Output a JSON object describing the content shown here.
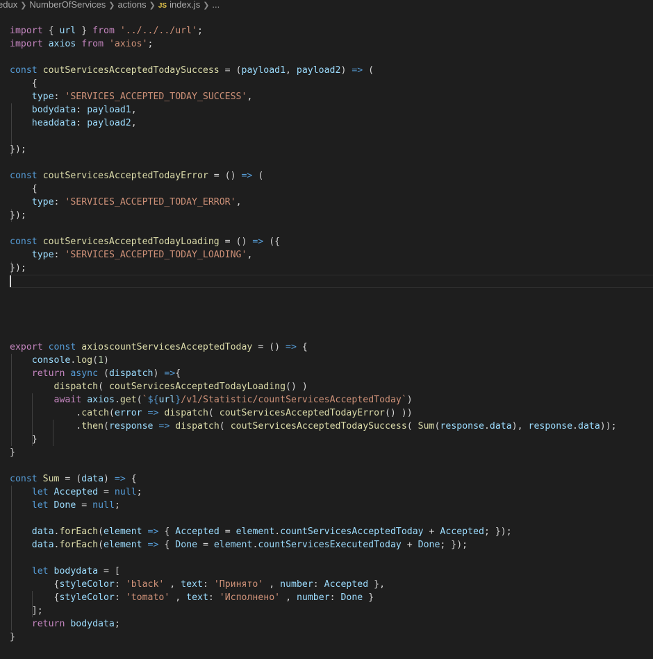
{
  "breadcrumb": {
    "items": [
      "edux",
      "NumberOfServices",
      "actions"
    ],
    "file_badge": "JS",
    "file_name": "index.js",
    "more": "..."
  },
  "editor": {
    "lines": [
      [
        [
          "kc",
          "import"
        ],
        [
          "t",
          " { "
        ],
        [
          "p",
          "url"
        ],
        [
          "t",
          " } "
        ],
        [
          "kc",
          "from"
        ],
        [
          "t",
          " "
        ],
        [
          "s",
          "'../../../url'"
        ],
        [
          "t",
          ";"
        ]
      ],
      [
        [
          "kc",
          "import"
        ],
        [
          "t",
          " "
        ],
        [
          "p",
          "axios"
        ],
        [
          "t",
          " "
        ],
        [
          "kc",
          "from"
        ],
        [
          "t",
          " "
        ],
        [
          "s",
          "'axios'"
        ],
        [
          "t",
          ";"
        ]
      ],
      [],
      [
        [
          "k",
          "const"
        ],
        [
          "t",
          " "
        ],
        [
          "fn",
          "coutServicesAcceptedTodaySuccess"
        ],
        [
          "t",
          " = ("
        ],
        [
          "p",
          "payload1"
        ],
        [
          "t",
          ", "
        ],
        [
          "p",
          "payload2"
        ],
        [
          "t",
          ") "
        ],
        [
          "k",
          "=>"
        ],
        [
          "t",
          " ("
        ]
      ],
      [
        [
          "t",
          "    {"
        ]
      ],
      [
        [
          "t",
          "    "
        ],
        [
          "p",
          "type"
        ],
        [
          "t",
          ": "
        ],
        [
          "s",
          "'SERVICES_ACCEPTED_TODAY_SUCCESS'"
        ],
        [
          "t",
          ","
        ]
      ],
      [
        [
          "t",
          "    "
        ],
        [
          "p",
          "bodydata"
        ],
        [
          "t",
          ": "
        ],
        [
          "p",
          "payload1"
        ],
        [
          "t",
          ","
        ]
      ],
      [
        [
          "t",
          "    "
        ],
        [
          "p",
          "headdata"
        ],
        [
          "t",
          ": "
        ],
        [
          "p",
          "payload2"
        ],
        [
          "t",
          ","
        ]
      ],
      [],
      [
        [
          "t",
          "});"
        ]
      ],
      [],
      [
        [
          "k",
          "const"
        ],
        [
          "t",
          " "
        ],
        [
          "fn",
          "coutServicesAcceptedTodayError"
        ],
        [
          "t",
          " = () "
        ],
        [
          "k",
          "=>"
        ],
        [
          "t",
          " ("
        ]
      ],
      [
        [
          "t",
          "    {"
        ]
      ],
      [
        [
          "t",
          "    "
        ],
        [
          "p",
          "type"
        ],
        [
          "t",
          ": "
        ],
        [
          "s",
          "'SERVICES_ACCEPTED_TODAY_ERROR'"
        ],
        [
          "t",
          ","
        ]
      ],
      [
        [
          "t",
          "});"
        ]
      ],
      [],
      [
        [
          "k",
          "const"
        ],
        [
          "t",
          " "
        ],
        [
          "fn",
          "coutServicesAcceptedTodayLoading"
        ],
        [
          "t",
          " = () "
        ],
        [
          "k",
          "=>"
        ],
        [
          "t",
          " ({"
        ]
      ],
      [
        [
          "t",
          "    "
        ],
        [
          "p",
          "type"
        ],
        [
          "t",
          ": "
        ],
        [
          "s",
          "'SERVICES_ACCEPTED_TODAY_LOADING'"
        ],
        [
          "t",
          ","
        ]
      ],
      [
        [
          "t",
          "});"
        ]
      ],
      [
        "CURSOR"
      ],
      [],
      [],
      [],
      [],
      [
        [
          "kc",
          "export"
        ],
        [
          "t",
          " "
        ],
        [
          "k",
          "const"
        ],
        [
          "t",
          " "
        ],
        [
          "fn",
          "axioscountServicesAcceptedToday"
        ],
        [
          "t",
          " = () "
        ],
        [
          "k",
          "=>"
        ],
        [
          "t",
          " {"
        ]
      ],
      [
        [
          "t",
          "    "
        ],
        [
          "p",
          "console"
        ],
        [
          "t",
          "."
        ],
        [
          "fn",
          "log"
        ],
        [
          "t",
          "("
        ],
        [
          "n",
          "1"
        ],
        [
          "t",
          ")"
        ]
      ],
      [
        [
          "t",
          "    "
        ],
        [
          "kc",
          "return"
        ],
        [
          "t",
          " "
        ],
        [
          "k",
          "async"
        ],
        [
          "t",
          " ("
        ],
        [
          "p",
          "dispatch"
        ],
        [
          "t",
          ") "
        ],
        [
          "k",
          "=>"
        ],
        [
          "t",
          "{"
        ]
      ],
      [
        [
          "t",
          "        "
        ],
        [
          "fn",
          "dispatch"
        ],
        [
          "t",
          "( "
        ],
        [
          "fn",
          "coutServicesAcceptedTodayLoading"
        ],
        [
          "t",
          "() )"
        ]
      ],
      [
        [
          "t",
          "        "
        ],
        [
          "kc",
          "await"
        ],
        [
          "t",
          " "
        ],
        [
          "p",
          "axios"
        ],
        [
          "t",
          "."
        ],
        [
          "fn",
          "get"
        ],
        [
          "t",
          "("
        ],
        [
          "s",
          "`"
        ],
        [
          "k",
          "${"
        ],
        [
          "p",
          "url"
        ],
        [
          "k",
          "}"
        ],
        [
          "s",
          "/v1/Statistic/countServicesAcceptedToday`"
        ],
        [
          "t",
          ")"
        ]
      ],
      [
        [
          "t",
          "            ."
        ],
        [
          "fn",
          "catch"
        ],
        [
          "t",
          "("
        ],
        [
          "p",
          "error"
        ],
        [
          "t",
          " "
        ],
        [
          "k",
          "=>"
        ],
        [
          "t",
          " "
        ],
        [
          "fn",
          "dispatch"
        ],
        [
          "t",
          "( "
        ],
        [
          "fn",
          "coutServicesAcceptedTodayError"
        ],
        [
          "t",
          "() ))"
        ]
      ],
      [
        [
          "t",
          "            ."
        ],
        [
          "fn",
          "then"
        ],
        [
          "t",
          "("
        ],
        [
          "p",
          "response"
        ],
        [
          "t",
          " "
        ],
        [
          "k",
          "=>"
        ],
        [
          "t",
          " "
        ],
        [
          "fn",
          "dispatch"
        ],
        [
          "t",
          "( "
        ],
        [
          "fn",
          "coutServicesAcceptedTodaySuccess"
        ],
        [
          "t",
          "( "
        ],
        [
          "fn",
          "Sum"
        ],
        [
          "t",
          "("
        ],
        [
          "p",
          "response"
        ],
        [
          "t",
          "."
        ],
        [
          "p",
          "data"
        ],
        [
          "t",
          "), "
        ],
        [
          "p",
          "response"
        ],
        [
          "t",
          "."
        ],
        [
          "p",
          "data"
        ],
        [
          "t",
          "));"
        ]
      ],
      [
        [
          "t",
          "    }"
        ]
      ],
      [
        [
          "t",
          "}"
        ]
      ],
      [],
      [
        [
          "k",
          "const"
        ],
        [
          "t",
          " "
        ],
        [
          "fn",
          "Sum"
        ],
        [
          "t",
          " = ("
        ],
        [
          "p",
          "data"
        ],
        [
          "t",
          ") "
        ],
        [
          "k",
          "=>"
        ],
        [
          "t",
          " {"
        ]
      ],
      [
        [
          "t",
          "    "
        ],
        [
          "k",
          "let"
        ],
        [
          "t",
          " "
        ],
        [
          "p",
          "Accepted"
        ],
        [
          "t",
          " = "
        ],
        [
          "k",
          "null"
        ],
        [
          "t",
          ";"
        ]
      ],
      [
        [
          "t",
          "    "
        ],
        [
          "k",
          "let"
        ],
        [
          "t",
          " "
        ],
        [
          "p",
          "Done"
        ],
        [
          "t",
          " = "
        ],
        [
          "k",
          "null"
        ],
        [
          "t",
          ";"
        ]
      ],
      [],
      [
        [
          "t",
          "    "
        ],
        [
          "p",
          "data"
        ],
        [
          "t",
          "."
        ],
        [
          "fn",
          "forEach"
        ],
        [
          "t",
          "("
        ],
        [
          "p",
          "element"
        ],
        [
          "t",
          " "
        ],
        [
          "k",
          "=>"
        ],
        [
          "t",
          " { "
        ],
        [
          "p",
          "Accepted"
        ],
        [
          "t",
          " = "
        ],
        [
          "p",
          "element"
        ],
        [
          "t",
          "."
        ],
        [
          "p",
          "countServicesAcceptedToday"
        ],
        [
          "t",
          " + "
        ],
        [
          "p",
          "Accepted"
        ],
        [
          "t",
          "; });"
        ]
      ],
      [
        [
          "t",
          "    "
        ],
        [
          "p",
          "data"
        ],
        [
          "t",
          "."
        ],
        [
          "fn",
          "forEach"
        ],
        [
          "t",
          "("
        ],
        [
          "p",
          "element"
        ],
        [
          "t",
          " "
        ],
        [
          "k",
          "=>"
        ],
        [
          "t",
          " { "
        ],
        [
          "p",
          "Done"
        ],
        [
          "t",
          " = "
        ],
        [
          "p",
          "element"
        ],
        [
          "t",
          "."
        ],
        [
          "p",
          "countServicesExecutedToday"
        ],
        [
          "t",
          " + "
        ],
        [
          "p",
          "Done"
        ],
        [
          "t",
          "; });"
        ]
      ],
      [],
      [
        [
          "t",
          "    "
        ],
        [
          "k",
          "let"
        ],
        [
          "t",
          " "
        ],
        [
          "p",
          "bodydata"
        ],
        [
          "t",
          " = ["
        ]
      ],
      [
        [
          "t",
          "        {"
        ],
        [
          "p",
          "styleColor"
        ],
        [
          "t",
          ": "
        ],
        [
          "s",
          "'black'"
        ],
        [
          "t",
          " , "
        ],
        [
          "p",
          "text"
        ],
        [
          "t",
          ": "
        ],
        [
          "s",
          "'Принято'"
        ],
        [
          "t",
          " , "
        ],
        [
          "p",
          "number"
        ],
        [
          "t",
          ": "
        ],
        [
          "p",
          "Accepted"
        ],
        [
          "t",
          " },"
        ]
      ],
      [
        [
          "t",
          "        {"
        ],
        [
          "p",
          "styleColor"
        ],
        [
          "t",
          ": "
        ],
        [
          "s",
          "'tomato'"
        ],
        [
          "t",
          " , "
        ],
        [
          "p",
          "text"
        ],
        [
          "t",
          ": "
        ],
        [
          "s",
          "'Исполнено'"
        ],
        [
          "t",
          " , "
        ],
        [
          "p",
          "number"
        ],
        [
          "t",
          ": "
        ],
        [
          "p",
          "Done"
        ],
        [
          "t",
          " }"
        ]
      ],
      [
        [
          "t",
          "    ];"
        ]
      ],
      [
        [
          "t",
          "    "
        ],
        [
          "kc",
          "return"
        ],
        [
          "t",
          " "
        ],
        [
          "p",
          "bodydata"
        ],
        [
          "t",
          ";"
        ]
      ],
      [
        [
          "t",
          "}"
        ]
      ]
    ]
  }
}
